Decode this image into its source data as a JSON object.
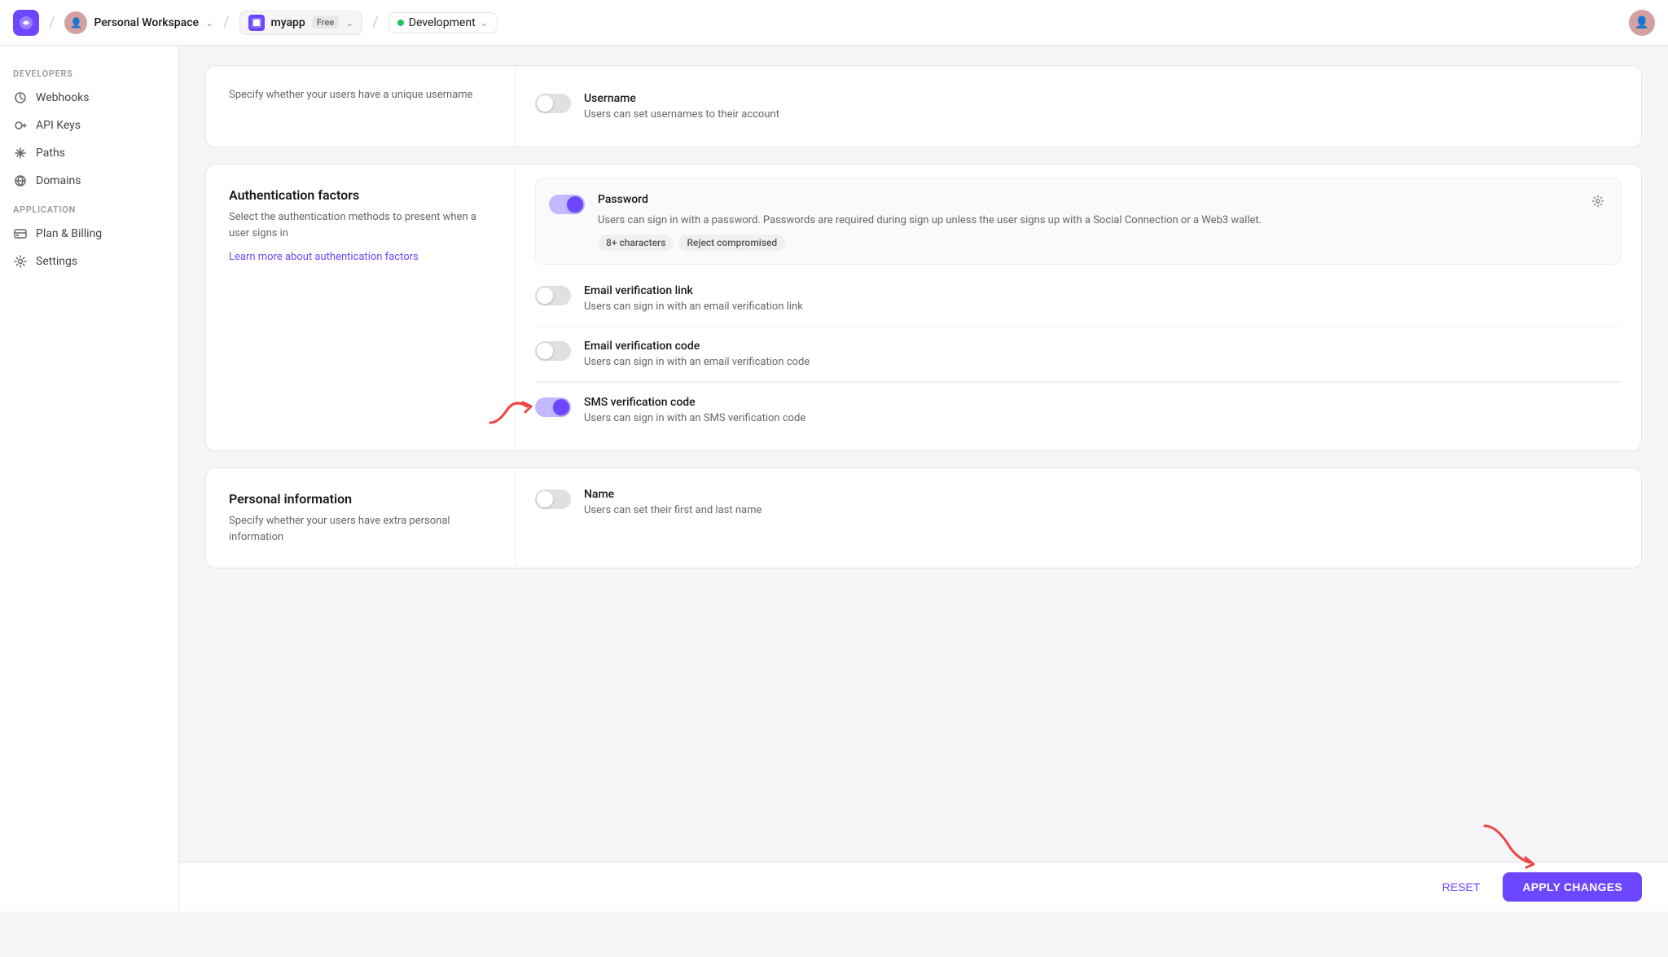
{
  "topnav": {
    "logo_letter": "C",
    "workspace_name": "Personal Workspace",
    "app_name": "myapp",
    "app_badge": "Free",
    "env_name": "Development"
  },
  "sidebar": {
    "sections": [
      {
        "label": "DEVELOPERS",
        "items": [
          {
            "id": "webhooks",
            "icon": "⚙",
            "label": "Webhooks"
          },
          {
            "id": "api-keys",
            "icon": "🔑",
            "label": "API Keys"
          },
          {
            "id": "paths",
            "icon": "🔗",
            "label": "Paths"
          },
          {
            "id": "domains",
            "icon": "🌐",
            "label": "Domains"
          }
        ]
      },
      {
        "label": "APPLICATION",
        "items": [
          {
            "id": "plan-billing",
            "icon": "📊",
            "label": "Plan & Billing"
          },
          {
            "id": "settings",
            "icon": "⚙",
            "label": "Settings"
          }
        ]
      }
    ]
  },
  "top_card": {
    "username_section": {
      "title": "Username",
      "description": "Specify whether your users have a unique username",
      "toggle_on": false,
      "feature_title": "Username",
      "feature_desc": "Users can set usernames to their account"
    }
  },
  "auth_card": {
    "title": "Authentication factors",
    "description": "Select the authentication methods to present when a user signs in",
    "link_text": "Learn more about authentication factors",
    "factors": [
      {
        "id": "password",
        "name": "Password",
        "description": "Users can sign in with a password. Passwords are required during sign up unless the user signs up with a Social Connection or a Web3 wallet.",
        "enabled": true,
        "has_settings": true,
        "tags": [
          "8+ characters",
          "Reject compromised"
        ]
      },
      {
        "id": "email-verification-link",
        "name": "Email verification link",
        "description": "Users can sign in with an email verification link",
        "enabled": false,
        "has_settings": false,
        "tags": []
      },
      {
        "id": "email-verification-code",
        "name": "Email verification code",
        "description": "Users can sign in with an email verification code",
        "enabled": false,
        "has_settings": false,
        "tags": []
      },
      {
        "id": "sms-verification-code",
        "name": "SMS verification code",
        "description": "Users can sign in with an SMS verification code",
        "enabled": true,
        "has_settings": false,
        "tags": [],
        "has_arrow": true
      }
    ]
  },
  "personal_info_card": {
    "title": "Personal information",
    "description": "Specify whether your users have extra personal information",
    "name_feature": {
      "title": "Name",
      "description": "Users can set their first and last name",
      "enabled": false
    }
  },
  "bottom_bar": {
    "reset_label": "RESET",
    "apply_label": "APPLY CHANGES"
  }
}
